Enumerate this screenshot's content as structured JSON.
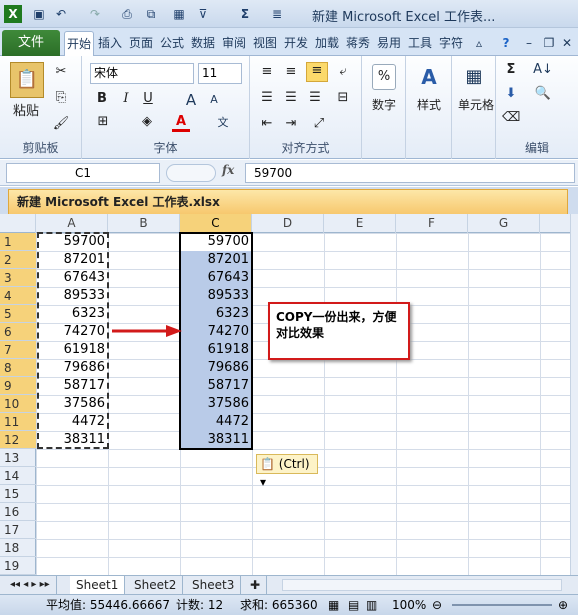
{
  "window": {
    "title": "新建 Microsoft Excel 工作表..."
  },
  "quick_access": [
    "excel-app-icon",
    "save-icon",
    "undo-icon",
    "redo-icon",
    "print-preview-icon",
    "format-icon",
    "date-icon",
    "filter-icon",
    "sum-icon",
    "align-icon"
  ],
  "ribbon_tabs": [
    "文件",
    "开始",
    "插入",
    "页面",
    "公式",
    "数据",
    "审阅",
    "视图",
    "开发",
    "加载",
    "蒋秀",
    "易用",
    "工具",
    "字符"
  ],
  "ribbon": {
    "clipboard": {
      "paste": "粘贴",
      "label": "剪贴板"
    },
    "font": {
      "name": "宋体",
      "size": "11",
      "label": "字体",
      "bold": "B",
      "italic": "I",
      "underline": "U",
      "grow": "A",
      "shrink": "A"
    },
    "alignment": {
      "label": "对齐方式"
    },
    "number": {
      "label": "数字",
      "button": "%"
    },
    "styles": {
      "label": "样式",
      "button": "A"
    },
    "cells": {
      "label": "单元格"
    },
    "editing": {
      "label": "编辑",
      "sum": "Σ"
    }
  },
  "formula_bar": {
    "name_box": "C1",
    "fx": "fx",
    "value": "59700"
  },
  "document_tab": "新建 Microsoft Excel 工作表.xlsx",
  "columns": [
    "A",
    "B",
    "C",
    "D",
    "E",
    "F",
    "G"
  ],
  "selected_column": "C",
  "rows": [
    "1",
    "2",
    "3",
    "4",
    "5",
    "6",
    "7",
    "8",
    "9",
    "10",
    "11",
    "12",
    "13",
    "14",
    "15",
    "16",
    "17",
    "18",
    "19"
  ],
  "selected_rows": 12,
  "column_a_values": [
    "59700",
    "87201",
    "67643",
    "89533",
    "6323",
    "74270",
    "61918",
    "79686",
    "58717",
    "37586",
    "4472",
    "38311"
  ],
  "column_c_values": [
    "59700",
    "87201",
    "67643",
    "89533",
    "6323",
    "74270",
    "61918",
    "79686",
    "58717",
    "37586",
    "4472",
    "38311"
  ],
  "callout": {
    "text": "COPY一份出来，方便对比效果"
  },
  "paste_options": "(Ctrl)",
  "sheets": [
    "Sheet1",
    "Sheet2",
    "Sheet3"
  ],
  "active_sheet": "Sheet1",
  "status": {
    "average": "平均值: 55446.66667",
    "count": "计数: 12",
    "sum": "求和: 665360",
    "zoom": "100%"
  }
}
